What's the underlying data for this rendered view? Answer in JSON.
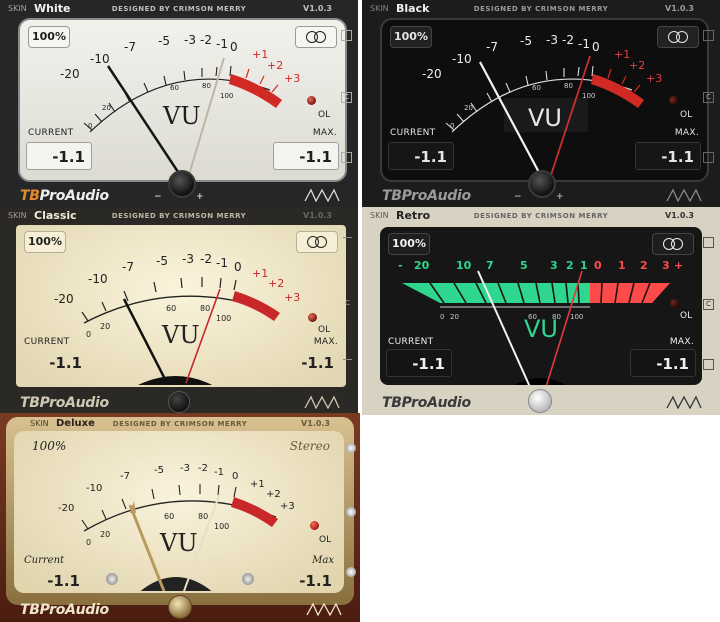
{
  "common": {
    "designed_by": "DESIGNED BY CRIMSON MERRY",
    "version": "V1.0.3",
    "skin_label": "SKIN",
    "zoom": "100%",
    "vu_label": "VU",
    "ol_label": "OL",
    "current_label": "CURRENT",
    "max_label": "MAX.",
    "current_value": "-1.1",
    "max_value": "-1.1",
    "brand_tb": "TB",
    "brand_rest": "ProAudio",
    "minus": "−",
    "plus": "+",
    "side_buttons": [
      "",
      "C",
      ""
    ],
    "scale_top": [
      "-20",
      "-10",
      "-7",
      "-5",
      "-3",
      "-2",
      "-1",
      "0",
      "+1",
      "+2",
      "+3"
    ],
    "scale_bottom": [
      "0",
      "20",
      "40",
      "60",
      "80",
      "100"
    ]
  },
  "panels": [
    {
      "skin": "White",
      "colors": {
        "panel": "#252628",
        "face": "#e7e6e0",
        "ink": "#1e1e1e",
        "red": "#d12a24",
        "bar_text": "#bfbfbf"
      }
    },
    {
      "skin": "Black",
      "colors": {
        "panel": "#1c1c1c",
        "face": "#101010",
        "ink": "#e6e6e6",
        "red": "#d12a24",
        "bar_text": "#9a9a9a"
      }
    },
    {
      "skin": "Classic",
      "colors": {
        "panel": "#2a2925",
        "face": "#ede4c8",
        "ink": "#222",
        "red": "#c8282a",
        "bar_text": "#bdb8a6"
      }
    },
    {
      "skin": "Retro",
      "colors": {
        "panel": "#d7d2c2",
        "face": "#161616",
        "ink": "#f0f0f0",
        "green": "#2fd68e",
        "red": "#ff4a4a",
        "bar_text": "#3a3a3a"
      },
      "retro_scale": [
        "-",
        "20",
        "10",
        "7",
        "5",
        "3",
        "2",
        "1",
        "0",
        "1",
        "2",
        "3",
        "+"
      ]
    },
    {
      "skin": "Deluxe",
      "colors": {
        "panel": "#6a2c1a",
        "face": "#f0e7ce",
        "ink": "#222",
        "red": "#c8282a",
        "gold": "#b99a5e",
        "bar_text": "#2b2218"
      },
      "deluxe_zoom": "100%",
      "deluxe_stereo": "Stereo",
      "deluxe_current": "Current",
      "deluxe_max": "Max"
    }
  ]
}
